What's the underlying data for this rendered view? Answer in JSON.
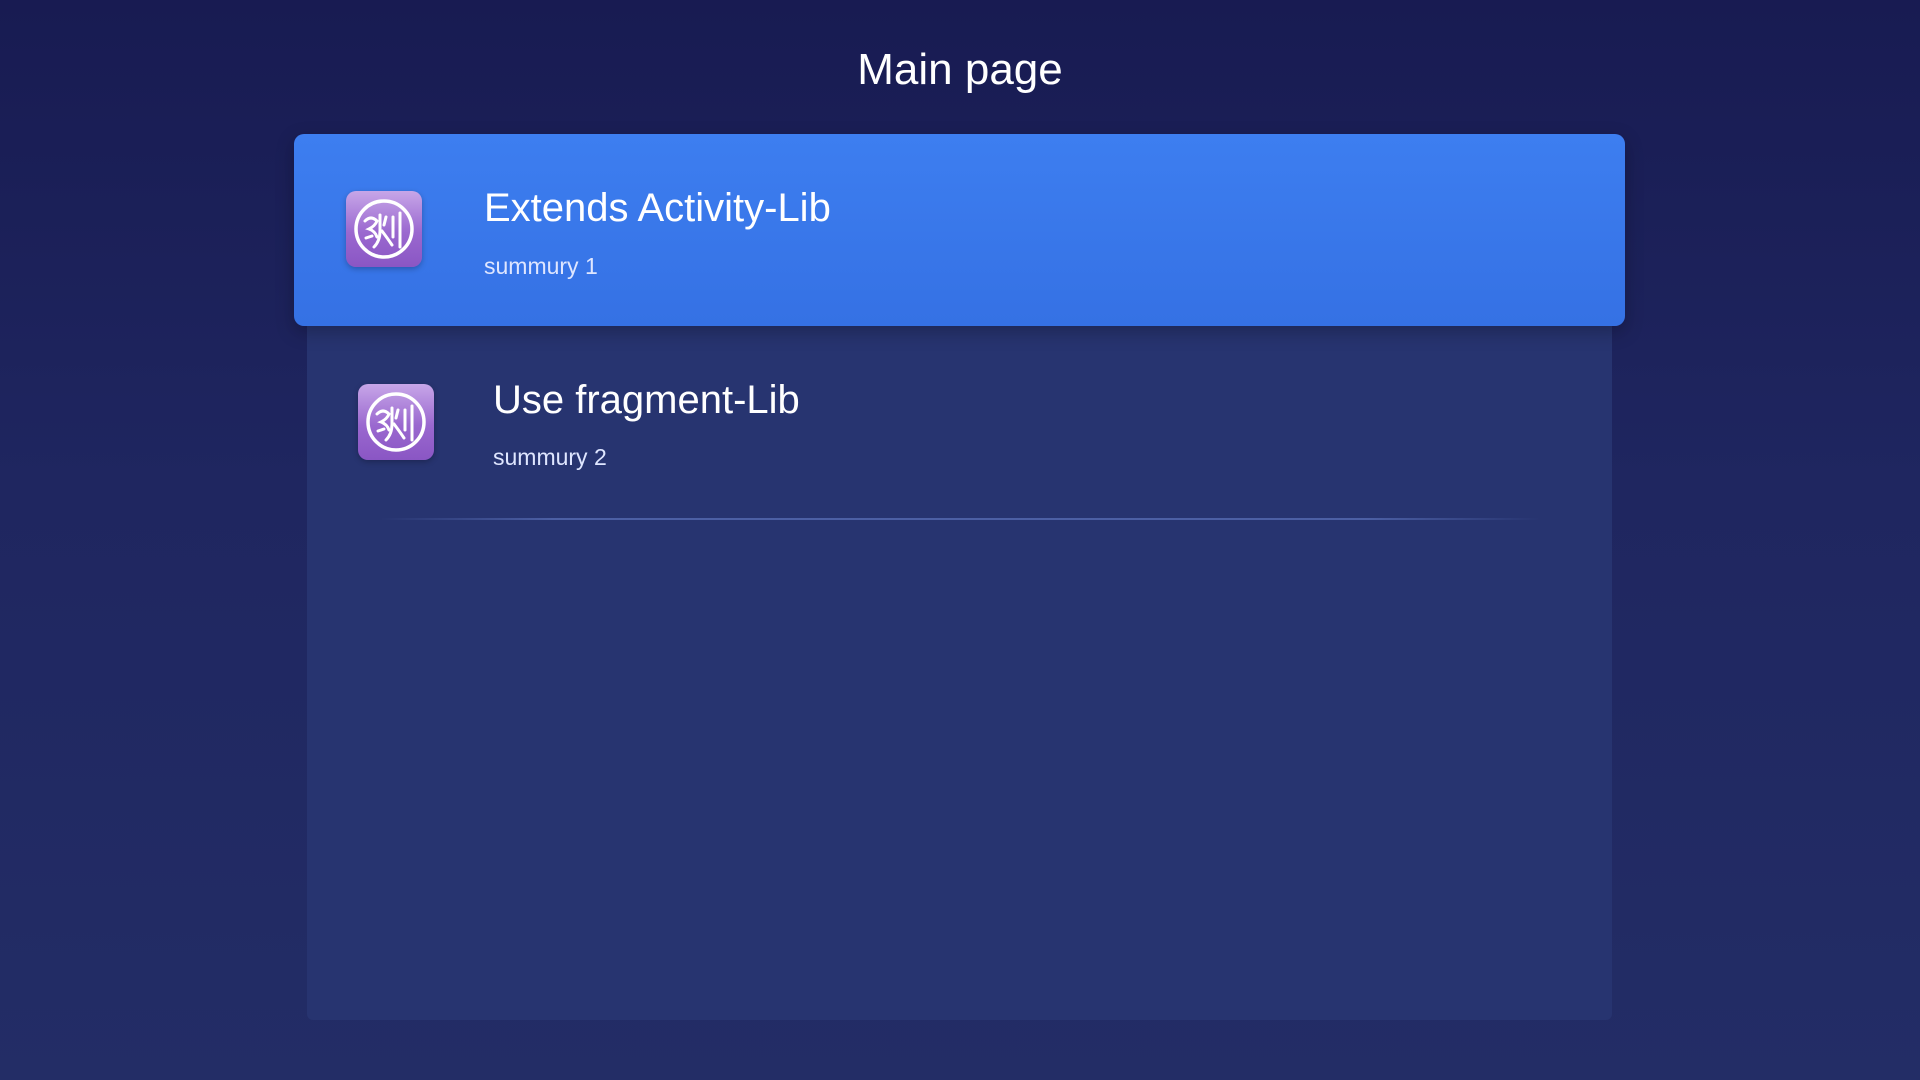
{
  "header": {
    "title": "Main page"
  },
  "list": {
    "items": [
      {
        "title": "Extends Activity-Lib",
        "summary": "summury 1",
        "icon": "app-logo-icon",
        "focused": true
      },
      {
        "title": "Use fragment-Lib",
        "summary": "summury 2",
        "icon": "app-logo-icon",
        "focused": false
      }
    ]
  },
  "colors": {
    "background": "#1b1f58",
    "panel": "#273470",
    "focus_highlight": "#3a79ec",
    "icon_tile": "#a574d6"
  }
}
